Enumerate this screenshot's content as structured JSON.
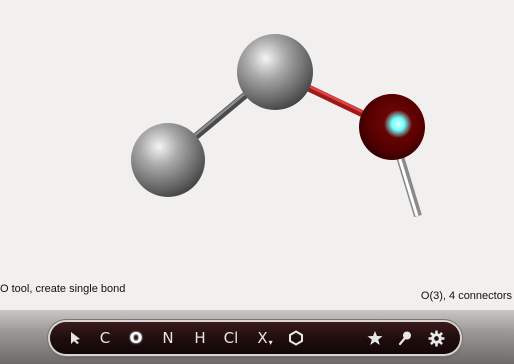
{
  "status": {
    "left": "O tool, create single bond",
    "right": "O(3), 4 connectors"
  },
  "toolbar": {
    "tools": [
      {
        "id": "select",
        "icon": "arrow-cursor-icon"
      },
      {
        "id": "carbon",
        "label": "C"
      },
      {
        "id": "oxygen",
        "label": "O",
        "active": true
      },
      {
        "id": "nitrogen",
        "label": "N"
      },
      {
        "id": "hydrogen",
        "label": "H"
      },
      {
        "id": "chlorine",
        "label": "Cl"
      },
      {
        "id": "other-element",
        "label": "X",
        "caret": "▾"
      },
      {
        "id": "ring",
        "icon": "hexagon-icon"
      },
      {
        "id": "favorite",
        "icon": "star-icon"
      },
      {
        "id": "probe",
        "icon": "pin-icon"
      },
      {
        "id": "settings",
        "icon": "gear-icon"
      }
    ]
  },
  "colors": {
    "background": "#f1f0ef",
    "carbon": "#808080",
    "oxygen": "#7a0000",
    "highlight": "#6fffff",
    "bond_red": "#cc2020",
    "toolbar_bg": "#1f0d0d"
  }
}
